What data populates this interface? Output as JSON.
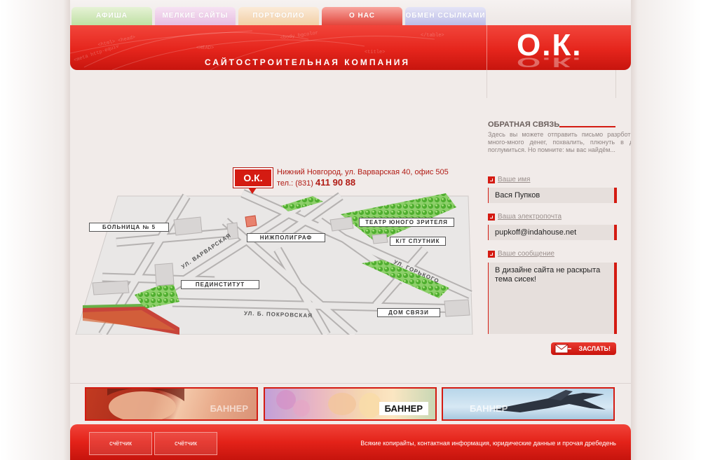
{
  "tabs": [
    {
      "label": "Афиша"
    },
    {
      "label": "Мелкие сайты"
    },
    {
      "label": "Портфолио"
    },
    {
      "label": "О нас",
      "active": true
    },
    {
      "label": "Обмен ссылками"
    }
  ],
  "header": {
    "tagline": "САЙТОСТРОИТЕЛЬНАЯ КОМПАНИЯ",
    "logo": "О.К."
  },
  "map": {
    "pin_label": "О.К.",
    "address": "Нижний Новгород, ул. Варварская 40, офис 505",
    "phone_prefix": "тел.: (831)",
    "phone_number": "411 90 88",
    "labels": {
      "hospital": "БОЛЬНИЦА № 5",
      "theatre": "ТЕАТР ЮНОГО ЗРИТЕЛЯ",
      "nizhpoligraf": "НИЖПОЛИГРАФ",
      "cinema": "К/Т СПУТНИК",
      "pedinstitut": "ПЕДИНСТИТУТ",
      "dom_svyazi": "ДОМ СВЯЗИ"
    },
    "streets": {
      "varvarskaya": "УЛ. ВАРВАРСКАЯ",
      "gorkogo": "УЛ. ГОРЬКОГО",
      "pokrovskaya": "УЛ. Б. ПОКРОВСКАЯ"
    }
  },
  "feedback": {
    "title": "ОБРАТНАЯ СВЯЗЬ",
    "description": "Здесь вы можете отправить письмо разрботчикам, пообещать много-много денег, похвалить, плюнуть в душу или просто поглумиться. Но помните: мы вас найдём...",
    "name_label": "Ваше имя",
    "name_value": "Вася Пупков",
    "email_label": "Ваша электропочта",
    "email_value": "pupkoff@indahouse.net",
    "message_label": "Ваше сообщение",
    "message_value": "В дизайне сайта не раскрыта тема сисек!",
    "send_label": "ЗАСЛАТЬ!"
  },
  "banners": [
    {
      "label": "БАННЕР"
    },
    {
      "label": "БАННЕР"
    },
    {
      "label": "БАННЕР"
    }
  ],
  "footer": {
    "counter_1": "счётчик",
    "counter_2": "счётчик",
    "text": "Всякие копирайты, контактная информация, юридические данные и прочая дребедень"
  },
  "colors": {
    "brand_red": "#e5251c",
    "page_bg": "#f1ebe9",
    "field_bg": "#e6dfdc"
  }
}
